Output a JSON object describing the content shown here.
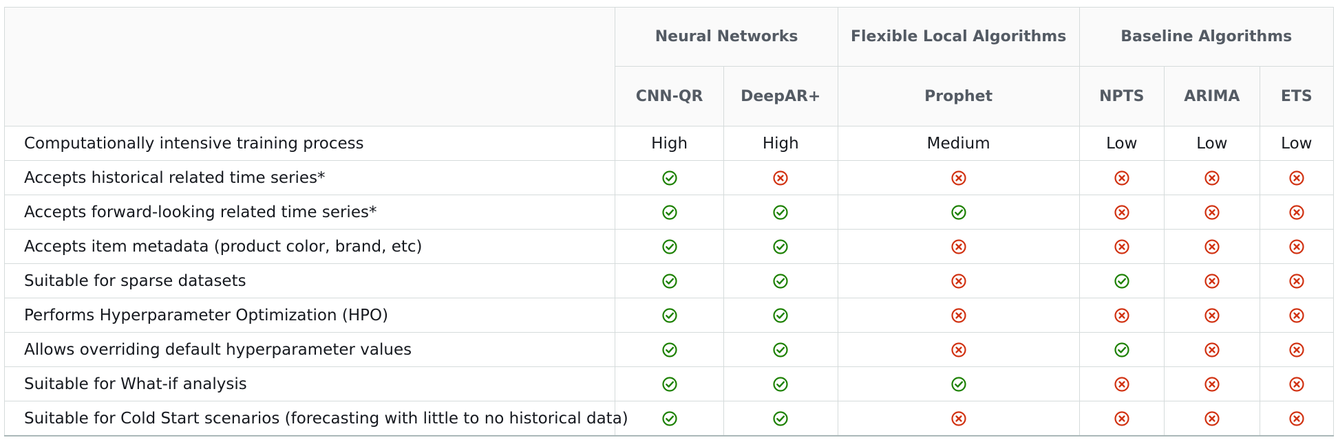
{
  "colors": {
    "yes": "#1d8102",
    "no": "#d13212",
    "header_bg": "#fafafa",
    "header_text": "#545b64",
    "border": "#d5dbdb"
  },
  "groups": [
    "Neural Networks",
    "Flexible Local Algorithms",
    "Baseline Algorithms"
  ],
  "algorithms": [
    "CNN-QR",
    "DeepAR+",
    "Prophet",
    "NPTS",
    "ARIMA",
    "ETS"
  ],
  "rows": [
    {
      "feature": "Computationally intensive training process",
      "cells": [
        "High",
        "High",
        "Medium",
        "Low",
        "Low",
        "Low"
      ]
    },
    {
      "feature": "Accepts historical related time series*",
      "cells": [
        "yes",
        "no",
        "no",
        "no",
        "no",
        "no"
      ]
    },
    {
      "feature": "Accepts forward-looking related time series*",
      "cells": [
        "yes",
        "yes",
        "yes",
        "no",
        "no",
        "no"
      ]
    },
    {
      "feature": "Accepts item metadata (product color, brand, etc)",
      "cells": [
        "yes",
        "yes",
        "no",
        "no",
        "no",
        "no"
      ]
    },
    {
      "feature": "Suitable for sparse datasets",
      "cells": [
        "yes",
        "yes",
        "no",
        "yes",
        "no",
        "no"
      ]
    },
    {
      "feature": "Performs Hyperparameter Optimization (HPO)",
      "cells": [
        "yes",
        "yes",
        "no",
        "no",
        "no",
        "no"
      ]
    },
    {
      "feature": "Allows overriding default hyperparameter values",
      "cells": [
        "yes",
        "yes",
        "no",
        "yes",
        "no",
        "no"
      ]
    },
    {
      "feature": "Suitable for What-if analysis",
      "cells": [
        "yes",
        "yes",
        "yes",
        "no",
        "no",
        "no"
      ]
    },
    {
      "feature": "Suitable for Cold Start scenarios (forecasting with little to no historical data)",
      "cells": [
        "yes",
        "yes",
        "no",
        "no",
        "no",
        "no"
      ]
    }
  ]
}
